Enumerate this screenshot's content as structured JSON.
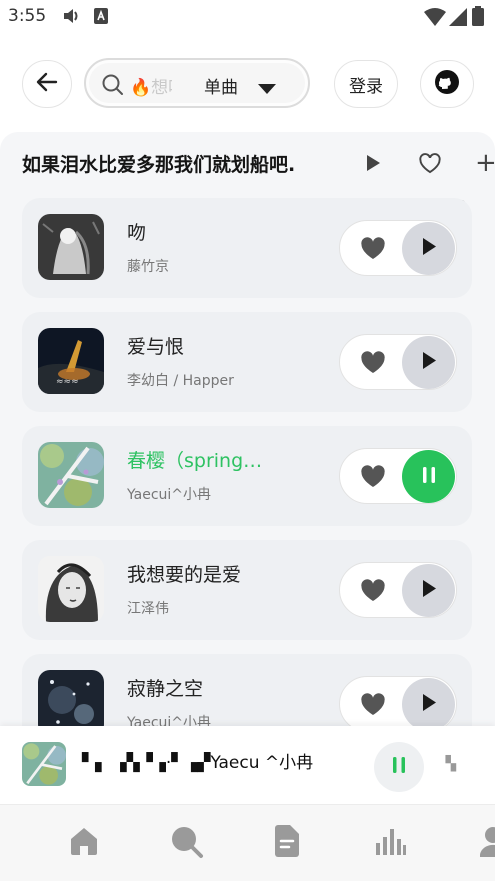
{
  "status": {
    "time": "3:55"
  },
  "search": {
    "placeholder": "🔥想听",
    "type_label": "单曲"
  },
  "header": {
    "login_label": "登录"
  },
  "playlist": {
    "title": "如果泪水比爱多那我们就划船吧."
  },
  "songs": [
    {
      "name": "吻",
      "artist": "藤竹京",
      "active": false
    },
    {
      "name": "爱与恨",
      "artist": "李幼白 / Happer",
      "active": false
    },
    {
      "name": "春樱（spring…",
      "artist": "Yaecui^小冉",
      "active": true
    },
    {
      "name": "我想要的是爱",
      "artist": "江泽伟",
      "active": false
    },
    {
      "name": "寂静之空",
      "artist": "Yaecui^小冉",
      "active": false
    }
  ],
  "now_playing": {
    "title": "▘▖ ▗▚▝▗·▘▗▞Yaecu ^小冉",
    "extra": "▝▖"
  },
  "colors": {
    "accent": "#28c25b",
    "card": "#eef0f3",
    "panel": "#f5f6f8"
  },
  "icons": [
    "back-arrow-icon",
    "search-icon",
    "caret-down-icon",
    "github-icon",
    "play-icon",
    "heart-icon",
    "plus-icon",
    "pause-icon",
    "home-icon",
    "search-tab-icon",
    "document-icon",
    "chart-bars-icon",
    "user-icon"
  ]
}
